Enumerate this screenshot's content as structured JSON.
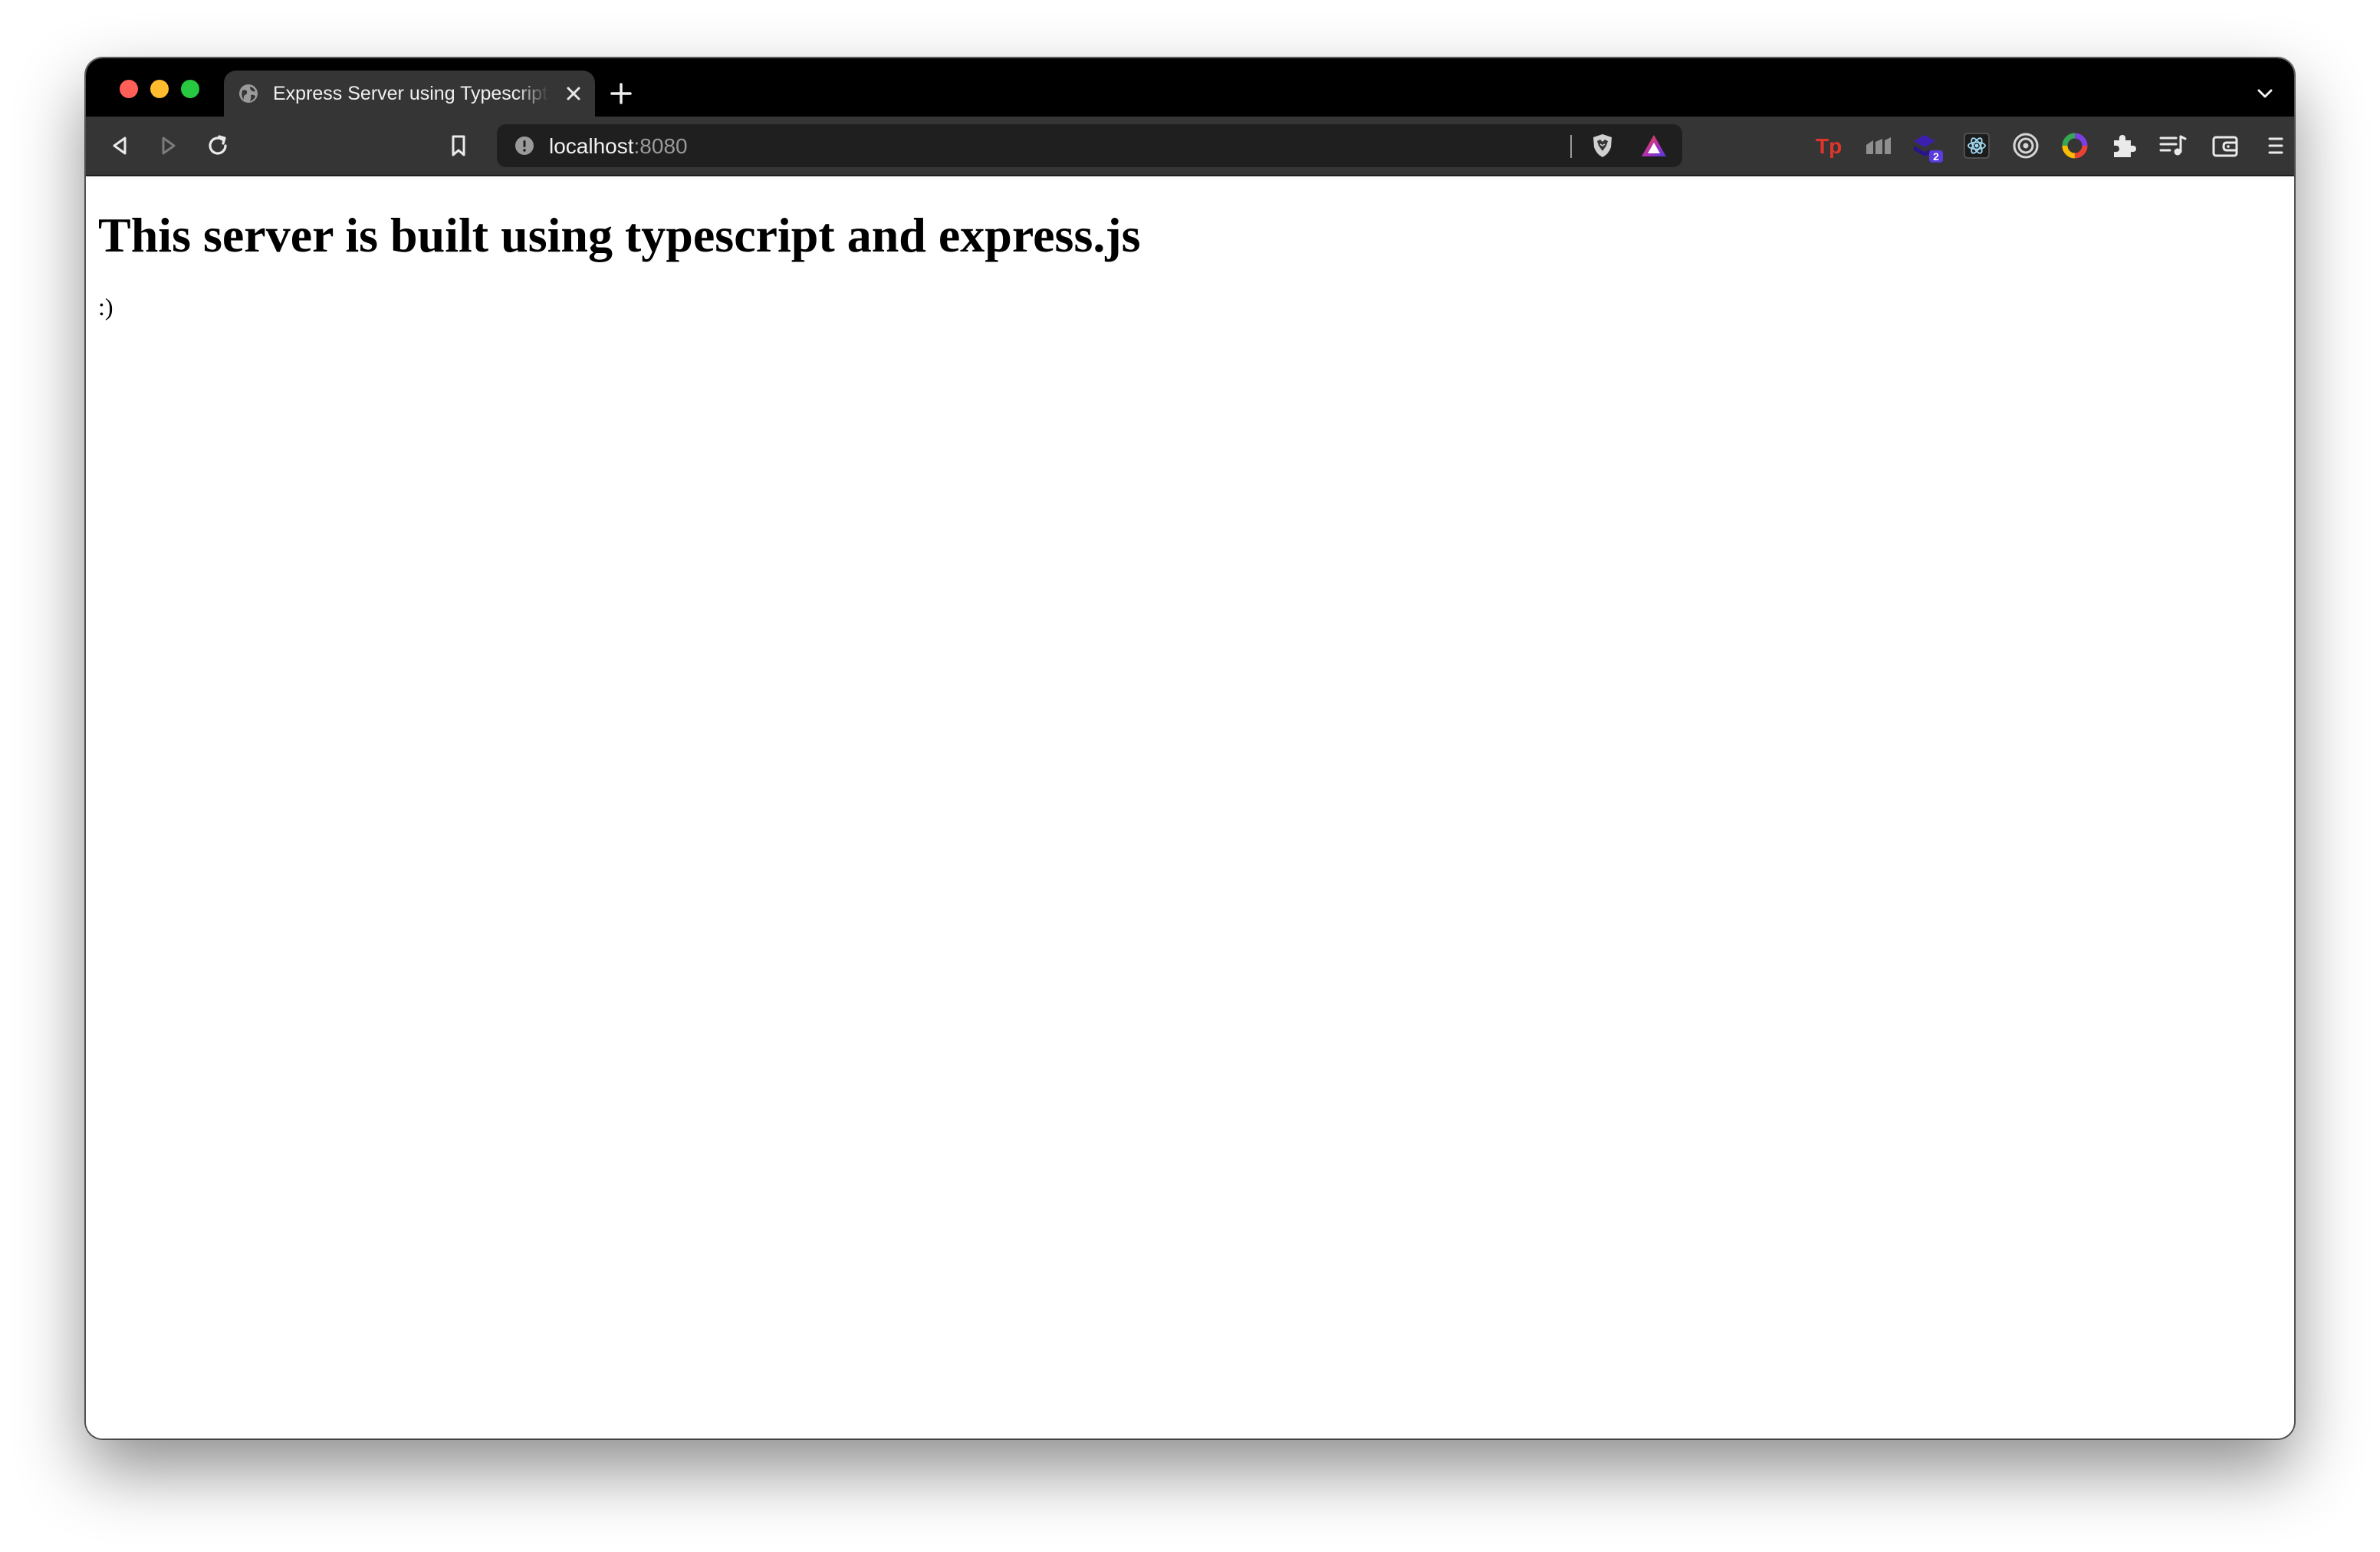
{
  "browser": {
    "tab": {
      "title": "Express Server using Typescript",
      "favicon": "globe-icon"
    },
    "toolbar": {
      "url_host": "localhost",
      "url_port": ":8080",
      "extensions": [
        {
          "name": "typing-tool-extension-icon",
          "label": "Tp"
        },
        {
          "name": "analytics-extension-icon"
        },
        {
          "name": "layers-extension-icon",
          "badge": "2"
        },
        {
          "name": "react-devtools-extension-icon"
        },
        {
          "name": "target-extension-icon"
        },
        {
          "name": "color-picker-extension-icon"
        },
        {
          "name": "puzzle-extensions-icon"
        },
        {
          "name": "reading-list-icon"
        },
        {
          "name": "wallet-icon"
        },
        {
          "name": "hamburger-menu-icon"
        }
      ]
    },
    "colors": {
      "tab_strip": "#000000",
      "toolbar": "#353535",
      "omnibox": "#1f1f1f",
      "accent_red": "#e0352b"
    }
  },
  "page": {
    "heading": "This server is built using typescript and express.js",
    "paragraph": ":)"
  }
}
